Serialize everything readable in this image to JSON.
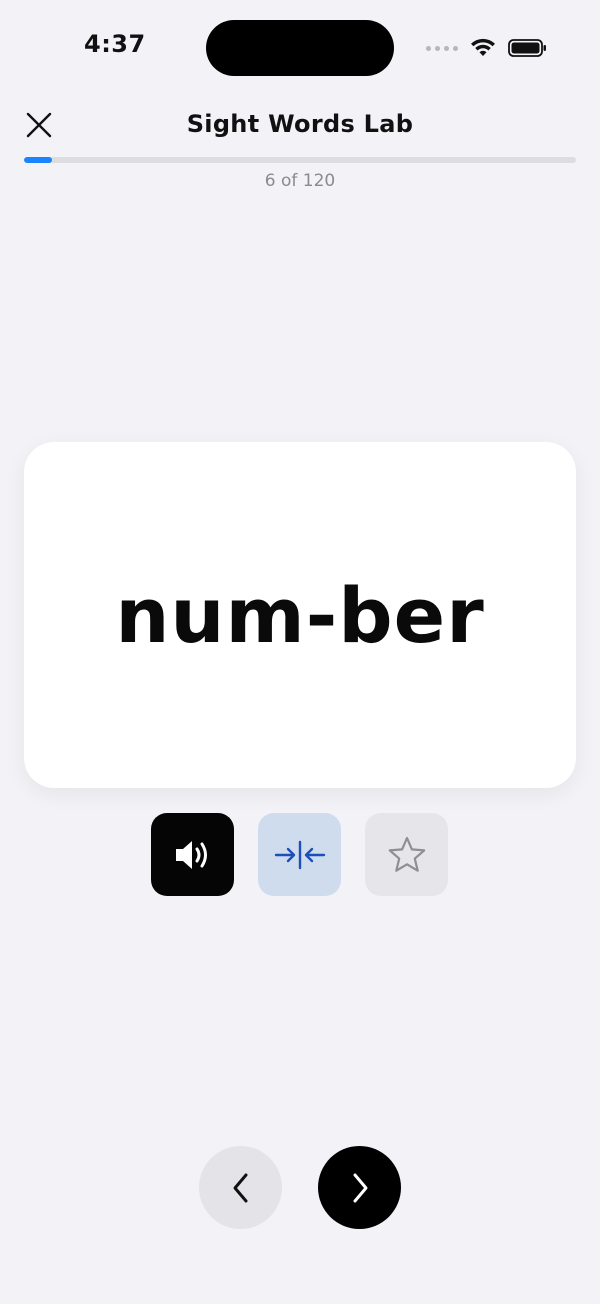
{
  "status_bar": {
    "time": "4:37"
  },
  "header": {
    "title": "Sight Words Lab",
    "close_icon": "close-icon"
  },
  "progress": {
    "current": 6,
    "total": 120,
    "label": "6 of 120",
    "fraction": 0.05,
    "color": "#1a84ff"
  },
  "card": {
    "word": "num-ber"
  },
  "actions": {
    "speak_icon": "speaker-icon",
    "split_icon": "split-syllables-icon",
    "favorite_icon": "star-icon"
  },
  "navigation": {
    "previous_icon": "chevron-left-icon",
    "next_icon": "chevron-right-icon"
  },
  "colors": {
    "background": "#f2f2f7",
    "accent": "#1a84ff",
    "split_active_bg": "#cfdcee",
    "split_icon": "#1d4fb8"
  }
}
